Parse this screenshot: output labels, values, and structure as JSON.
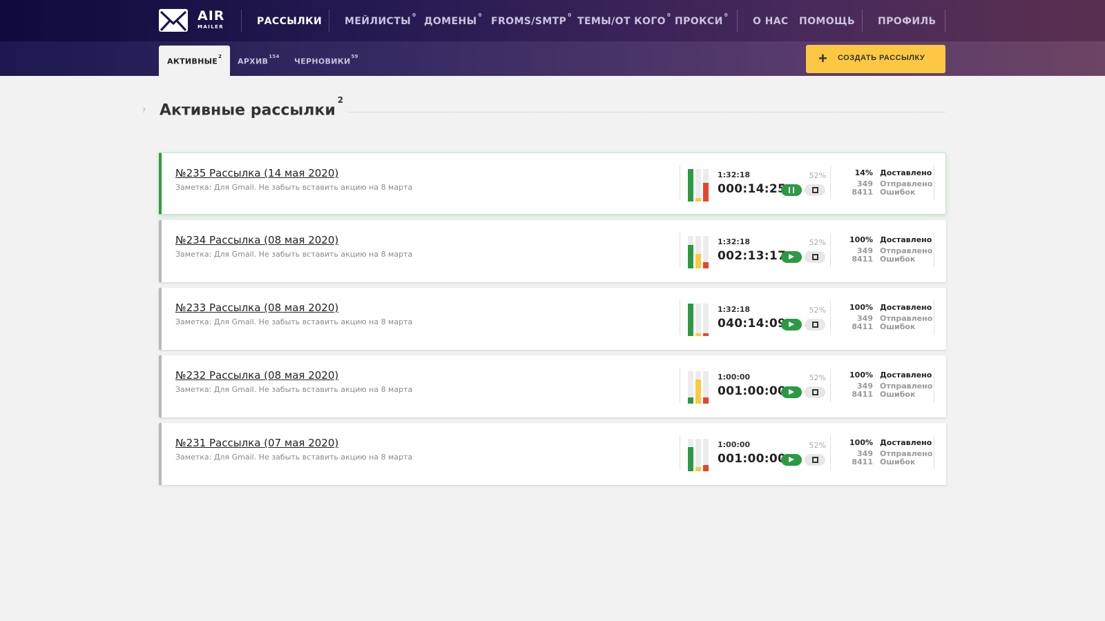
{
  "logo": {
    "air": "AIR",
    "mailer": "MAILER"
  },
  "nav": [
    {
      "label": "РАССЫЛКИ",
      "badge": ""
    },
    {
      "label": "МЕЙЛИСТЫ",
      "badge": "0"
    },
    {
      "label": "ДОМЕНЫ",
      "badge": "0"
    },
    {
      "label": "FROMS/SMTP",
      "badge": "0"
    },
    {
      "label": "ТЕМЫ/ОТ КОГО",
      "badge": "0"
    },
    {
      "label": "ПРОКСИ",
      "badge": "0"
    },
    {
      "label": "О НАС",
      "badge": ""
    },
    {
      "label": "ПОМОЩЬ",
      "badge": ""
    },
    {
      "label": "ПРОФИЛЬ",
      "badge": ""
    }
  ],
  "tabs": [
    {
      "label": "АКТИВНЫЕ",
      "badge": "2"
    },
    {
      "label": "АРХИВ",
      "badge": "154"
    },
    {
      "label": "ЧЕРНОВИКИ",
      "badge": "59"
    }
  ],
  "create_button": "СОЗДАТЬ РАССЫЛКУ",
  "help_mark": "?",
  "page": {
    "title": "Активные рассылки",
    "count": "2"
  },
  "colors": {
    "green": "#2b9a43",
    "yellow": "#fcc843",
    "red": "#e5452f",
    "accent": "#fcc843"
  },
  "stat_labels": {
    "delivered": "Доставлено",
    "sent": "Отправлено",
    "errors": "Ошибок"
  },
  "campaigns": [
    {
      "title": "№235 Рассылка (14 мая 2020)",
      "note": "Заметка: Для Gmail. Не забыть вставить акцию на 8 марта",
      "time_small": "1:32:18",
      "time_big": "000:14:25",
      "pct": "52%",
      "state": "running",
      "delivered": "14%",
      "sent": "349",
      "errors": "8411",
      "bar_levels": [
        1.0,
        0.1,
        0.58
      ]
    },
    {
      "title": "№234 Рассылка (08 мая 2020)",
      "note": "Заметка: Для Gmail. Не забыть вставить акцию на 8 марта",
      "time_small": "1:32:18",
      "time_big": "002:13:17",
      "pct": "52%",
      "state": "paused",
      "delivered": "100%",
      "sent": "349",
      "errors": "8411",
      "bar_levels": [
        0.72,
        0.45,
        0.2
      ]
    },
    {
      "title": "№233 Рассылка (08 мая 2020)",
      "note": "Заметка: Для Gmail. Не забыть вставить акцию на 8 марта",
      "time_small": "1:32:18",
      "time_big": "040:14:09",
      "pct": "52%",
      "state": "paused",
      "delivered": "100%",
      "sent": "349",
      "errors": "8411",
      "bar_levels": [
        1.0,
        0.08,
        0.08
      ]
    },
    {
      "title": "№232 Рассылка (08 мая 2020)",
      "note": "Заметка: Для Gmail. Не забыть вставить акцию на 8 марта",
      "time_small": "1:00:00",
      "time_big": "001:00:00",
      "pct": "52%",
      "state": "paused",
      "delivered": "100%",
      "sent": "349",
      "errors": "8411",
      "bar_levels": [
        0.2,
        0.75,
        0.2
      ]
    },
    {
      "title": "№231 Рассылка (07 мая 2020)",
      "note": "Заметка: Для Gmail. Не забыть вставить акцию на 8 марта",
      "time_small": "1:00:00",
      "time_big": "001:00:00",
      "pct": "52%",
      "state": "paused",
      "delivered": "100%",
      "sent": "349",
      "errors": "8411",
      "bar_levels": [
        0.75,
        0.12,
        0.2
      ]
    }
  ]
}
